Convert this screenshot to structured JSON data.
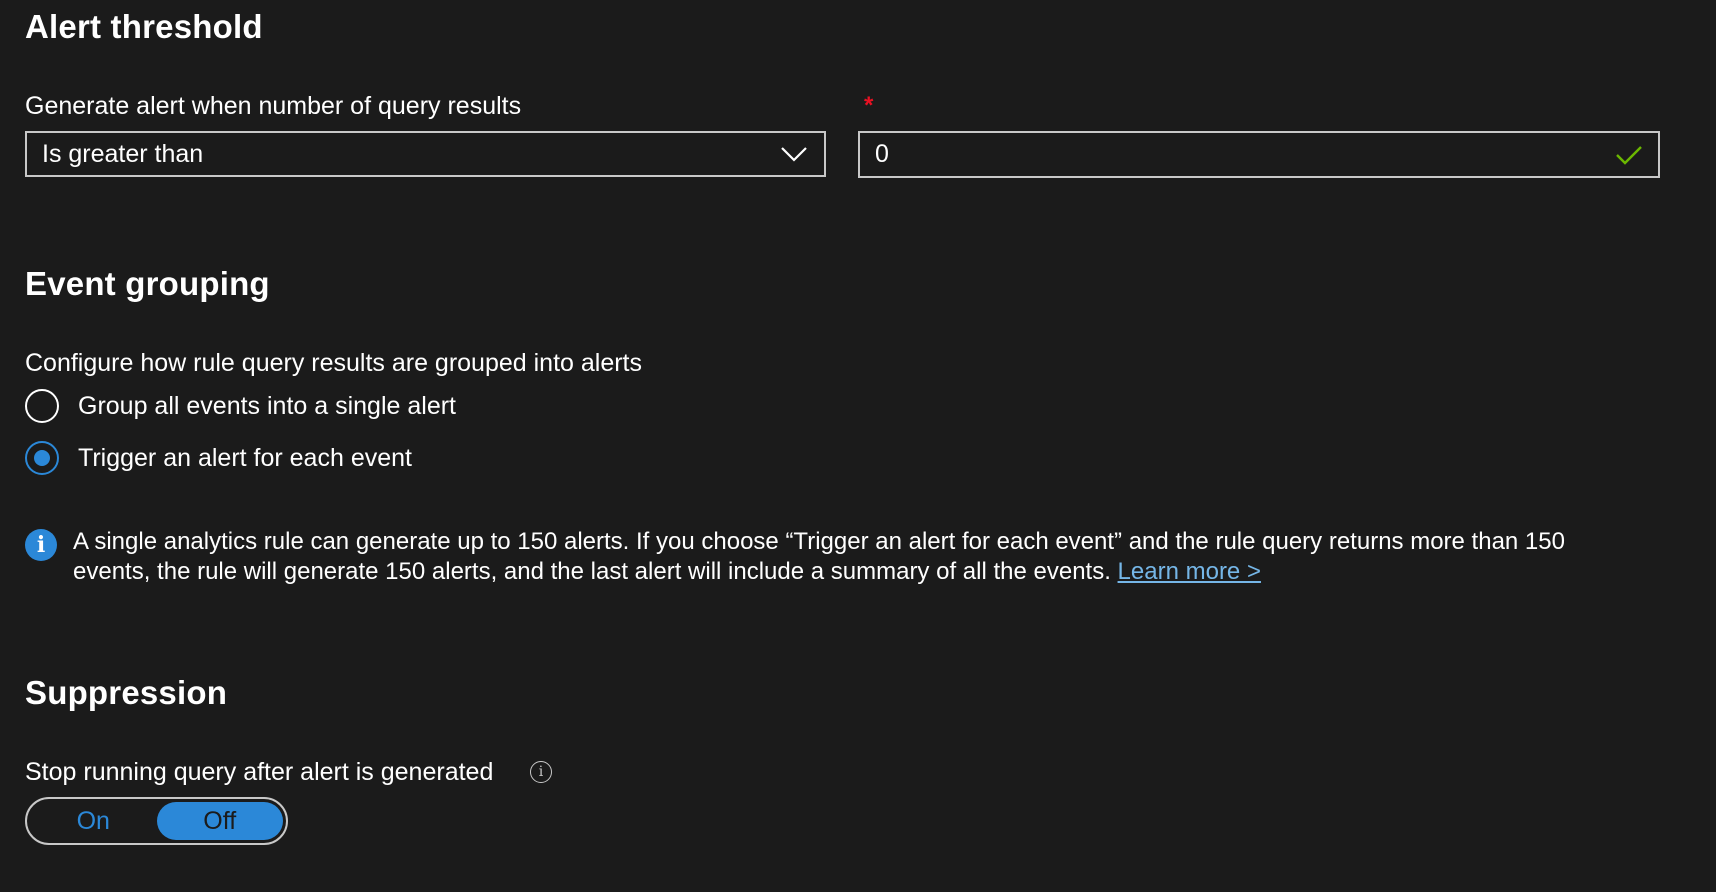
{
  "alert_threshold": {
    "title": "Alert threshold",
    "label": "Generate alert when number of query results",
    "required_mark": "*",
    "operator_value": "Is greater than",
    "threshold_value": "0"
  },
  "event_grouping": {
    "title": "Event grouping",
    "label": "Configure how rule query results are grouped into alerts",
    "options": [
      {
        "label": "Group all events into a single alert",
        "selected": false
      },
      {
        "label": "Trigger an alert for each event",
        "selected": true
      }
    ],
    "info_icon_glyph": "i",
    "info_text": "A single analytics rule can generate up to 150 alerts. If you choose “Trigger an alert for each event” and the rule query returns more than 150 events, the rule will generate 150 alerts, and the last alert will include a summary of all the events. ",
    "learn_more": "Learn more >"
  },
  "suppression": {
    "title": "Suppression",
    "label": "Stop running query after alert is generated",
    "tooltip_glyph": "i",
    "toggle": {
      "on_label": "On",
      "off_label": "Off",
      "selected": "Off"
    }
  },
  "colors": {
    "background": "#1b1b1b",
    "accent": "#2b88d8",
    "required": "#e81123",
    "valid": "#6bb700",
    "link": "#75b6e7"
  },
  "icons": [
    "chevron-down-icon",
    "checkmark-icon",
    "info-icon",
    "tooltip-info-icon"
  ]
}
